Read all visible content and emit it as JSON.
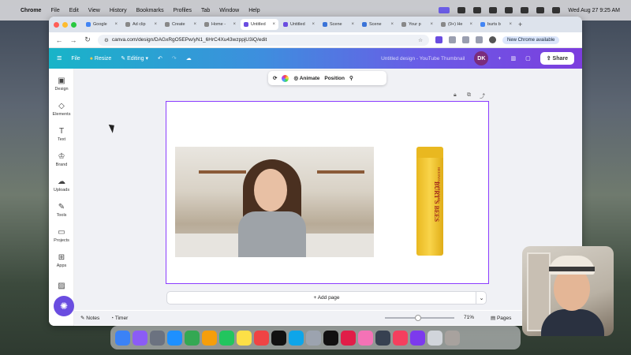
{
  "menubar": {
    "app": "Chrome",
    "items": [
      "File",
      "Edit",
      "View",
      "History",
      "Bookmarks",
      "Profiles",
      "Tab",
      "Window",
      "Help"
    ],
    "clock": "Wed Aug 27  9:25 AM"
  },
  "tabs": [
    {
      "label": "Google"
    },
    {
      "label": "Ad clip"
    },
    {
      "label": "Create"
    },
    {
      "label": "Home -"
    },
    {
      "label": "Untitled",
      "active": true
    },
    {
      "label": "Untitled"
    },
    {
      "label": "Scene"
    },
    {
      "label": "Scene"
    },
    {
      "label": "Your p"
    },
    {
      "label": "(9+) He"
    },
    {
      "label": "burts b"
    }
  ],
  "browser": {
    "url": "canva.com/design/DAGxRgO5EPw/yN1_6HrC4Xu43wzppjU3iQ/edit",
    "new_chrome": "New Chrome available"
  },
  "canva_header": {
    "file": "File",
    "resize": "Resize",
    "editing": "Editing",
    "doc_title": "Untitled design - YouTube Thumbnail",
    "avatar": "DK",
    "share": "Share"
  },
  "sidebar": {
    "items": [
      {
        "label": "Design",
        "icon": "layout-icon"
      },
      {
        "label": "Elements",
        "icon": "shapes-icon"
      },
      {
        "label": "Text",
        "icon": "text-icon"
      },
      {
        "label": "Brand",
        "icon": "brand-icon"
      },
      {
        "label": "Uploads",
        "icon": "cloud-upload-icon"
      },
      {
        "label": "Tools",
        "icon": "pen-icon"
      },
      {
        "label": "Projects",
        "icon": "folder-icon"
      },
      {
        "label": "Apps",
        "icon": "grid-icon"
      }
    ]
  },
  "float_toolbar": {
    "animate": "Animate",
    "position": "Position"
  },
  "product": {
    "brand": "BURT'S BEES",
    "sub": "BEESWAX LIP BALM"
  },
  "add_page": "+ Add page",
  "footer": {
    "notes": "Notes",
    "timer": "Timer",
    "zoom": "71%",
    "pages": "Pages",
    "zoom_level": 0.71
  },
  "colors": {
    "canva_purple": "#8b3dff",
    "header_start": "#18b4c8",
    "header_end": "#7c3dde"
  }
}
